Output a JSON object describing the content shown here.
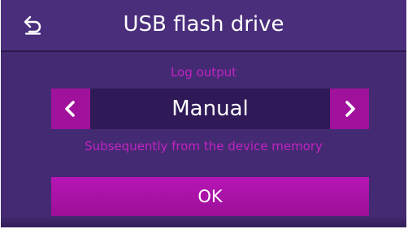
{
  "header": {
    "title": "USB flash drive",
    "back_icon": "undo-arrow-icon"
  },
  "log_output": {
    "label": "Log output",
    "value": "Manual",
    "description": "Subsequently from the device memory",
    "prev_icon": "chevron-left-icon",
    "next_icon": "chevron-right-icon"
  },
  "ok_button": {
    "label": "OK"
  },
  "colors": {
    "background": "#442a72",
    "header": "#4a2e7c",
    "accent": "#a0129c",
    "label_text": "#c223c4",
    "value_field": "#2f1957"
  }
}
